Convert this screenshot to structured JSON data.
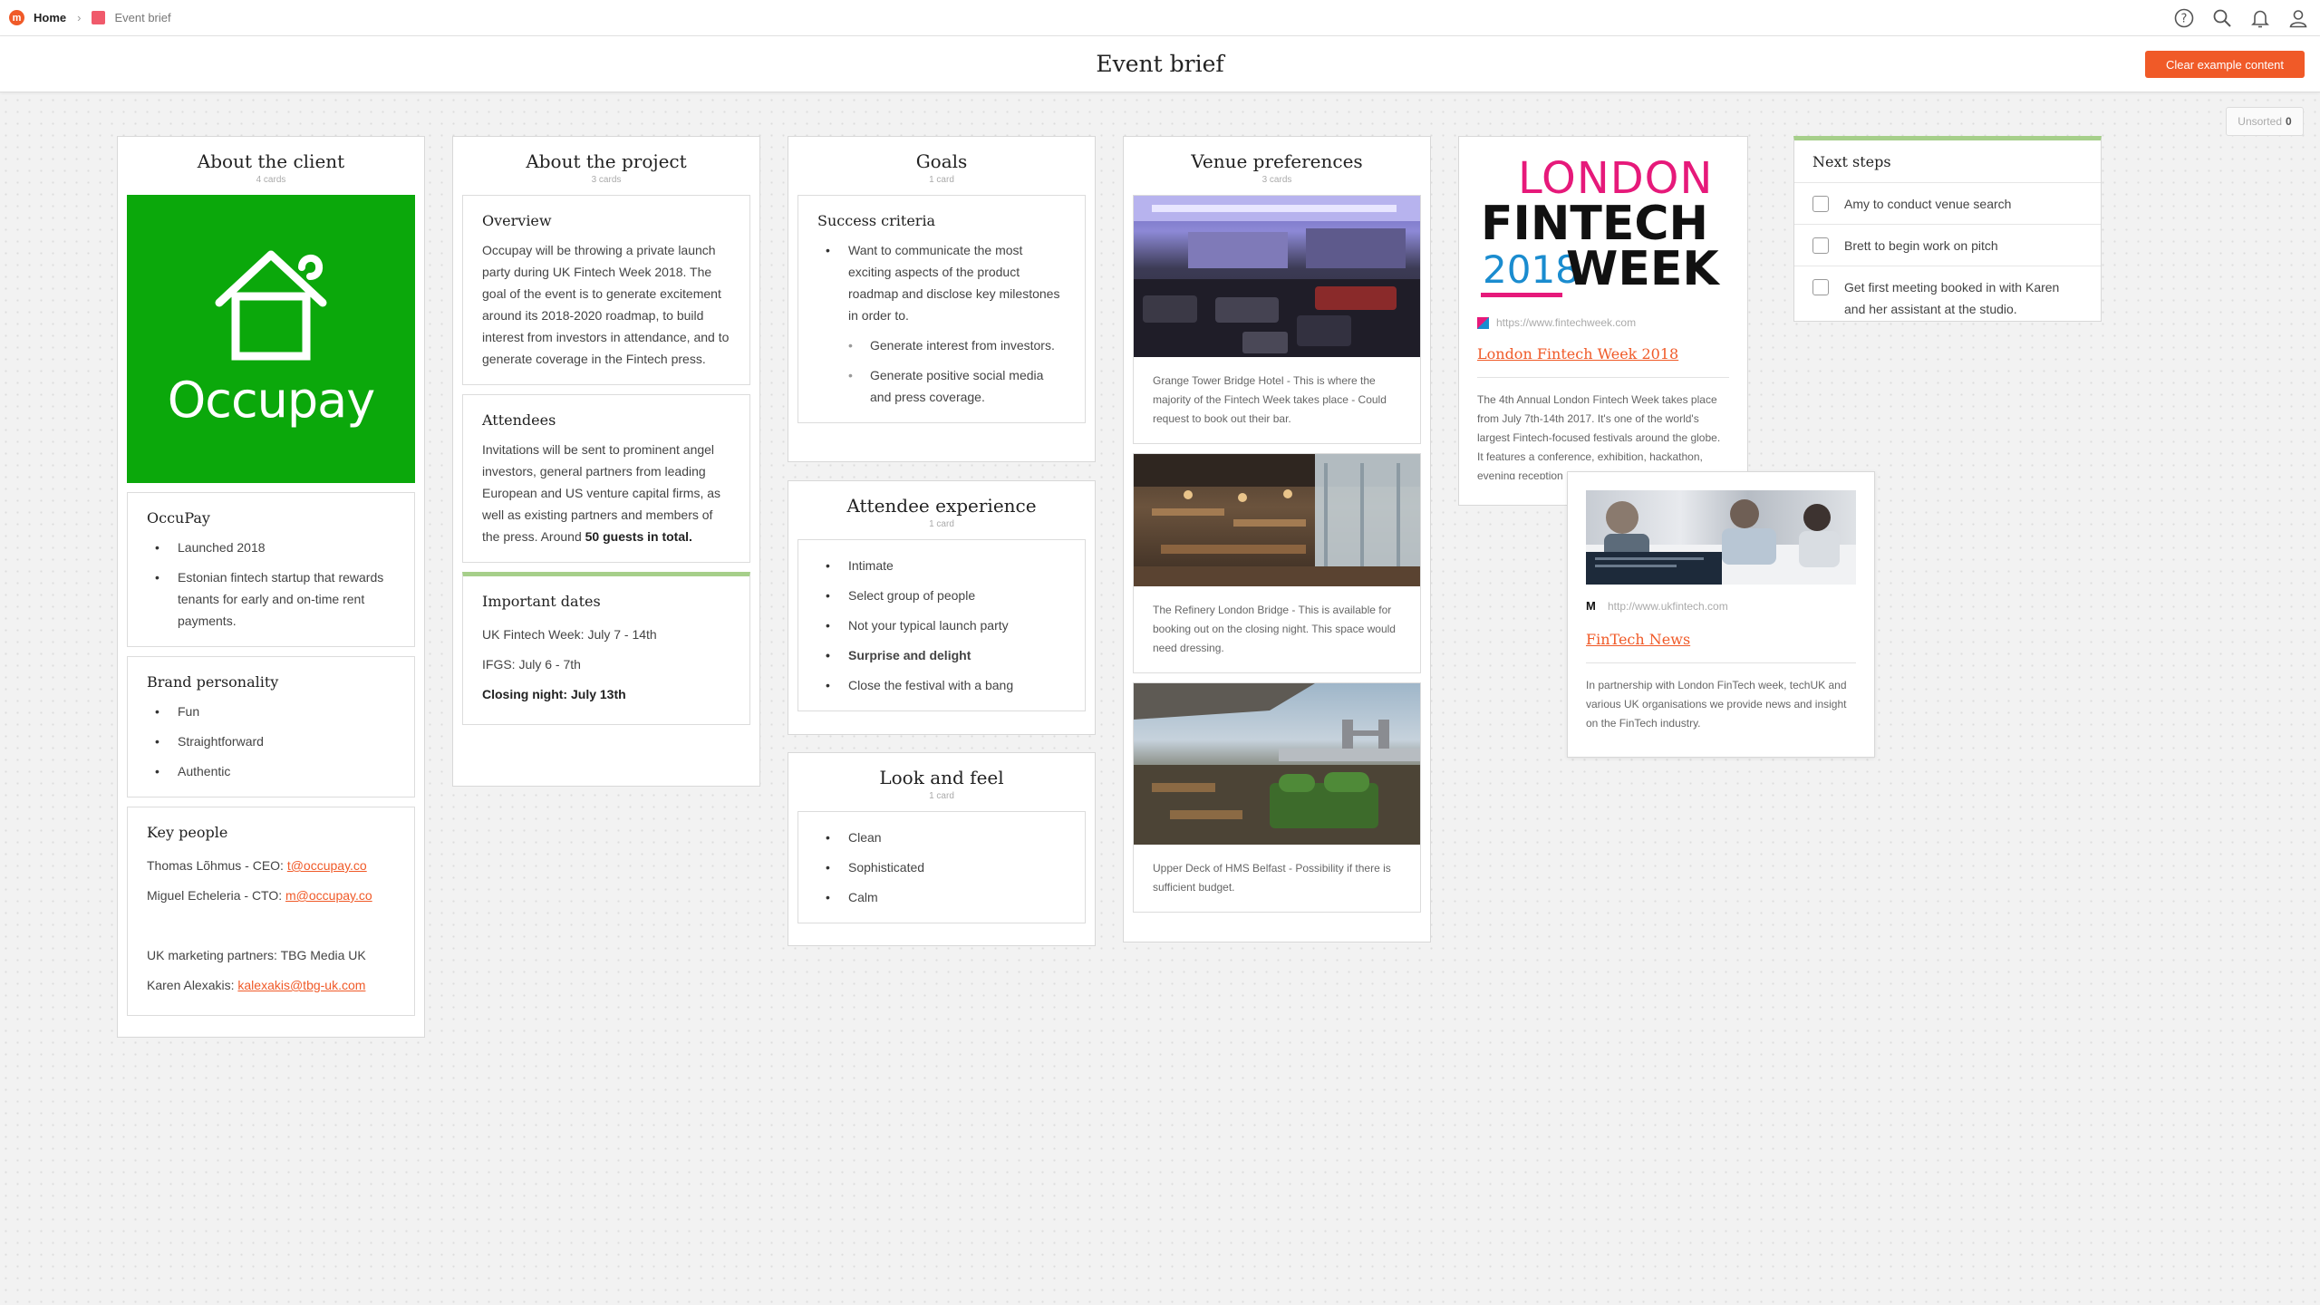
{
  "nav": {
    "logo_glyph": "m",
    "home": "Home",
    "board": "Event brief",
    "icons": [
      "help-icon",
      "search-icon",
      "notifications-icon",
      "account-icon"
    ]
  },
  "header": {
    "title": "Event brief",
    "clear_button": "Clear example content",
    "unsorted_label": "Unsorted",
    "unsorted_count": "0"
  },
  "colors": {
    "accent": "#f05a28",
    "green": "#0ba80b",
    "highlight": "#a6cf8a"
  },
  "client": {
    "title": "About the client",
    "count": "4 cards",
    "logo_text": "Occupay",
    "occupay": {
      "title": "OccuPay",
      "items": [
        "Launched 2018",
        "Estonian fintech startup that rewards tenants for early and on-time rent payments."
      ]
    },
    "brand": {
      "title": "Brand personality",
      "items": [
        "Fun",
        "Straightforward",
        "Authentic"
      ]
    },
    "people": {
      "title": "Key people",
      "p1_name": "Thomas Lõhmus - CEO: ",
      "p1_email": "t@occupay.co",
      "p2_name": "Miguel Echeleria - CTO: ",
      "p2_email": "m@occupay.co",
      "partners": "UK marketing partners: TBG Media UK",
      "p3_name": "Karen Alexakis: ",
      "p3_email": "kalexakis@tbg-uk.com"
    }
  },
  "project": {
    "title": "About the project",
    "count": "3 cards",
    "overview": {
      "title": "Overview",
      "text": "Occupay will be throwing a private launch party during UK Fintech Week 2018. The goal of the event is to generate excitement around its 2018-2020 roadmap, to build interest from investors in attendance, and to generate coverage in the Fintech press."
    },
    "attendees": {
      "title": "Attendees",
      "text": "Invitations will be sent to prominent angel investors, general partners from leading European and US venture capital firms, as well as existing partners and members of the press. Around ",
      "bold": "50 guests in total."
    },
    "dates": {
      "title": "Important dates",
      "line1": "UK Fintech Week: July 7 - 14th",
      "line2": "IFGS: July 6 - 7th",
      "line3": "Closing night: July 13th"
    }
  },
  "goals": {
    "title": "Goals",
    "count": "1 card",
    "card_title": "Success criteria",
    "main": "Want to communicate the most exciting aspects of the product roadmap and disclose key milestones in order to.",
    "sub": [
      "Generate interest from investors.",
      "Generate positive social media and press coverage."
    ]
  },
  "experience": {
    "title": "Attendee experience",
    "count": "1 card",
    "items": [
      "Intimate",
      "Select group of people",
      "Not your typical launch party",
      "Surprise and delight",
      "Close the festival with a bang"
    ]
  },
  "look": {
    "title": "Look and feel",
    "count": "1 card",
    "items": [
      "Clean",
      "Sophisticated",
      "Calm"
    ]
  },
  "venue": {
    "title": "Venue preferences",
    "count": "3 cards",
    "captions": [
      "Grange Tower Bridge Hotel - This is where the majority of the Fintech Week takes place - Could request to book out their bar.",
      "The Refinery London Bridge - This is available for booking out on the closing night. This space would need dressing.",
      "Upper Deck of HMS Belfast - Possibility if there is sufficient budget."
    ]
  },
  "fintech_week": {
    "logo_line1": "LONDON",
    "logo_line2": "FINTECH",
    "logo_year": "2018",
    "logo_week": "WEEK",
    "domain": "https://www.fintechweek.com",
    "title": "London Fintech Week 2018",
    "desc": "The 4th Annual London Fintech Week takes place from July 7th-14th 2017. It's one of the world's largest Fintech-focused festivals around the globe. It features a conference, exhibition, hackathon, evening reception"
  },
  "fintech_news": {
    "favicon": "M",
    "domain": "http://www.ukfintech.com",
    "title": "FinTech News",
    "desc": "In partnership with London FinTech week, techUK and various UK organisations we provide news and insight on the FinTech industry."
  },
  "next_steps": {
    "title": "Next steps",
    "items": [
      "Amy to conduct venue search",
      "Brett to begin work on pitch",
      "Get first meeting booked in with Karen and her assistant at the studio."
    ]
  }
}
